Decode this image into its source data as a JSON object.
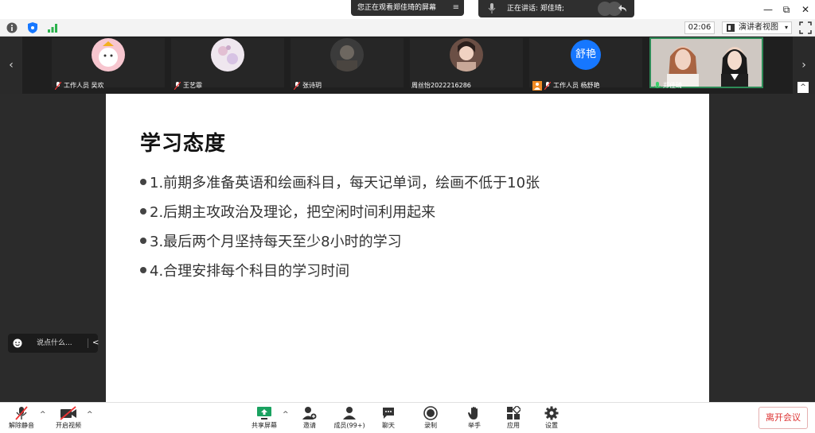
{
  "titlebar": {
    "viewing_text": "您正在观看郑佳琦的屏幕",
    "menu_glyph": "≡",
    "speaking_text": "正在讲话: 郑佳琦;",
    "minimize": "—",
    "restore": "⧉",
    "close": "✕"
  },
  "toolbar": {
    "timer": "02:06",
    "presenter_view": "演讲者视图"
  },
  "participants": [
    {
      "name": "工作人员 吴欢",
      "avatar": "cartoon-avatar"
    },
    {
      "name": "王艺霏",
      "avatar": "floral-avatar"
    },
    {
      "name": "张诗玥",
      "avatar": "photo-avatar"
    },
    {
      "name": "周丝怡2022216286",
      "avatar": "photo-avatar"
    },
    {
      "name": "工作人员 杨舒艳",
      "avatar_text": "舒艳"
    },
    {
      "name": "郑佳琦",
      "avatar": "video-feed"
    }
  ],
  "strip_nav": {
    "left": "‹",
    "right": "›",
    "collapse": "^"
  },
  "slide": {
    "title": "学习态度",
    "bullets": [
      "1.前期多准备英语和绘画科目，每天记单词，绘画不低于10张",
      "2.后期主攻政治及理论，把空闲时间利用起来",
      "3.最后两个月坚持每天至少8小时的学习",
      "4.合理安排每个科目的学习时间"
    ]
  },
  "chat": {
    "placeholder": "说点什么...",
    "collapse": "<"
  },
  "bottom": {
    "unmute": "解除静音",
    "start_video": "开启视频",
    "share_screen": "共享屏幕",
    "invite": "邀请",
    "members": "成员(99+)",
    "chat": "聊天",
    "record": "录制",
    "raise_hand": "举手",
    "apps": "应用",
    "settings": "设置",
    "leave": "离开会议",
    "caret": "^"
  },
  "colors": {
    "accent_blue": "#1677ff",
    "share_green": "#1aa260",
    "leave_red": "#d33333",
    "active_border": "#2e8b57"
  }
}
